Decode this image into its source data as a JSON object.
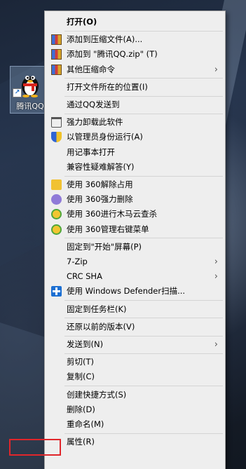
{
  "desktop": {
    "icon_label": "腾讯QQ"
  },
  "menu": [
    {
      "label": "打开(O)",
      "bold": true,
      "icon": "",
      "submenu": false
    },
    {
      "sep": true
    },
    {
      "label": "添加到压缩文件(A)...",
      "icon": "winrar-archive-icon",
      "submenu": false
    },
    {
      "label": "添加到 \"腾讯QQ.zip\" (T)",
      "icon": "winrar-archive-icon",
      "submenu": false
    },
    {
      "label": "其他压缩命令",
      "icon": "winrar-archive-icon",
      "submenu": true
    },
    {
      "sep": true
    },
    {
      "label": "打开文件所在的位置(I)",
      "icon": "",
      "submenu": false
    },
    {
      "sep": true
    },
    {
      "label": "通过QQ发送到",
      "icon": "",
      "submenu": false
    },
    {
      "sep": true
    },
    {
      "label": "强力卸载此软件",
      "icon": "trash-bin-icon",
      "submenu": false
    },
    {
      "label": "以管理员身份运行(A)",
      "icon": "uac-shield-icon",
      "submenu": false
    },
    {
      "label": "用记事本打开",
      "icon": "",
      "submenu": false
    },
    {
      "label": "兼容性疑难解答(Y)",
      "icon": "",
      "submenu": false
    },
    {
      "sep": true
    },
    {
      "label": "使用 360解除占用",
      "icon": "360-unlock-icon",
      "submenu": false
    },
    {
      "label": "使用 360强力删除",
      "icon": "360-shred-icon",
      "submenu": false
    },
    {
      "label": "使用 360进行木马云查杀",
      "icon": "360-scan-icon",
      "submenu": false
    },
    {
      "label": "使用 360管理右键菜单",
      "icon": "360-scan-icon",
      "submenu": false
    },
    {
      "sep": true
    },
    {
      "label": "固定到\"开始\"屏幕(P)",
      "icon": "",
      "submenu": false
    },
    {
      "label": "7-Zip",
      "icon": "",
      "submenu": true
    },
    {
      "label": "CRC SHA",
      "icon": "",
      "submenu": true
    },
    {
      "label": "使用 Windows Defender扫描...",
      "icon": "windows-defender-icon",
      "submenu": false
    },
    {
      "sep": true
    },
    {
      "label": "固定到任务栏(K)",
      "icon": "",
      "submenu": false
    },
    {
      "sep": true
    },
    {
      "label": "还原以前的版本(V)",
      "icon": "",
      "submenu": false
    },
    {
      "sep": true
    },
    {
      "label": "发送到(N)",
      "icon": "",
      "submenu": true
    },
    {
      "sep": true
    },
    {
      "label": "剪切(T)",
      "icon": "",
      "submenu": false
    },
    {
      "label": "复制(C)",
      "icon": "",
      "submenu": false
    },
    {
      "sep": true
    },
    {
      "label": "创建快捷方式(S)",
      "icon": "",
      "submenu": false
    },
    {
      "label": "删除(D)",
      "icon": "",
      "submenu": false
    },
    {
      "label": "重命名(M)",
      "icon": "",
      "submenu": false
    },
    {
      "sep": true
    },
    {
      "label": "属性(R)",
      "icon": "",
      "submenu": false
    }
  ],
  "colors": {
    "highlight_box": "#e0262b",
    "menu_bg": "#eeeeee"
  }
}
